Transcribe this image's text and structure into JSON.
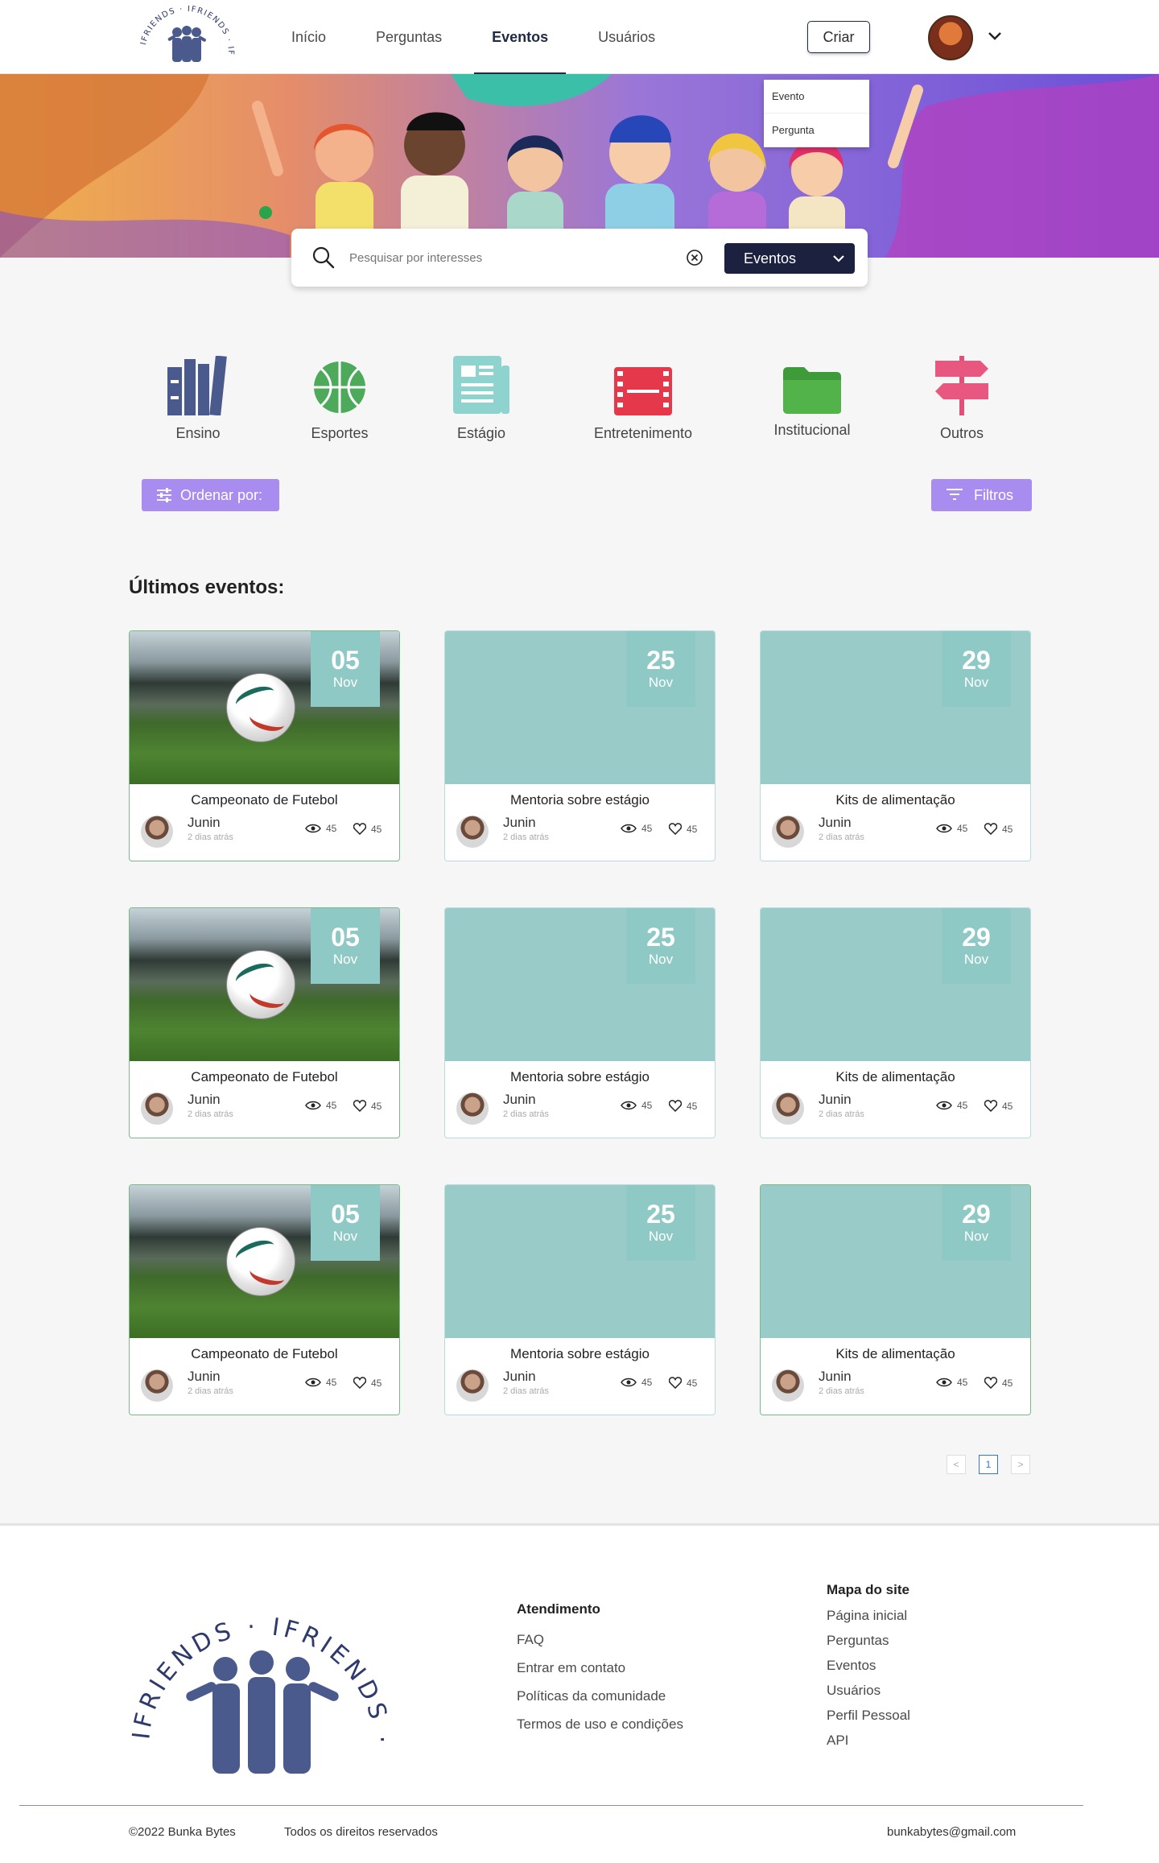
{
  "header": {
    "logo_text": "IFRIENDS",
    "nav": [
      "Início",
      "Perguntas",
      "Eventos",
      "Usuários"
    ],
    "active_nav": "Eventos",
    "create_label": "Criar",
    "create_menu": [
      "Evento",
      "Pergunta"
    ]
  },
  "search": {
    "placeholder": "Pesquisar por interesses",
    "type_selected": "Eventos"
  },
  "categories": [
    "Ensino",
    "Esportes",
    "Estágio",
    "Entretenimento",
    "Institucional",
    "Outros"
  ],
  "controls": {
    "sort_label": "Ordenar por:",
    "filter_label": "Filtros"
  },
  "section_title": "Últimos eventos:",
  "cards": [
    {
      "day": "05",
      "month": "Nov",
      "title": "Campeonato de Futebol",
      "author": "Junin",
      "time": "2 dias atrás",
      "views": "45",
      "likes": "45"
    },
    {
      "day": "25",
      "month": "Nov",
      "title": "Mentoria sobre estágio",
      "author": "Junin",
      "time": "2 dias atrás",
      "views": "45",
      "likes": "45"
    },
    {
      "day": "29",
      "month": "Nov",
      "title": "Kits de alimentação",
      "author": "Junin",
      "time": "2 dias atrás",
      "views": "45",
      "likes": "45"
    },
    {
      "day": "05",
      "month": "Nov",
      "title": "Campeonato de Futebol",
      "author": "Junin",
      "time": "2 dias atrás",
      "views": "45",
      "likes": "45"
    },
    {
      "day": "25",
      "month": "Nov",
      "title": "Mentoria sobre estágio",
      "author": "Junin",
      "time": "2 dias atrás",
      "views": "45",
      "likes": "45"
    },
    {
      "day": "29",
      "month": "Nov",
      "title": "Kits de alimentação",
      "author": "Junin",
      "time": "2 dias atrás",
      "views": "45",
      "likes": "45"
    },
    {
      "day": "05",
      "month": "Nov",
      "title": "Campeonato de Futebol",
      "author": "Junin",
      "time": "2 dias atrás",
      "views": "45",
      "likes": "45"
    },
    {
      "day": "25",
      "month": "Nov",
      "title": "Mentoria sobre estágio",
      "author": "Junin",
      "time": "2 dias atrás",
      "views": "45",
      "likes": "45"
    },
    {
      "day": "29",
      "month": "Nov",
      "title": "Kits de alimentação",
      "author": "Junin",
      "time": "2 dias atrás",
      "views": "45",
      "likes": "45"
    }
  ],
  "pagination": {
    "prev": "<",
    "current": "1",
    "next": ">"
  },
  "footer": {
    "logo_text": "IFRIENDS",
    "atendimento": {
      "title": "Atendimento",
      "links": [
        "FAQ",
        "Entrar em contato",
        "Políticas da comunidade",
        "Termos de uso e condições"
      ]
    },
    "mapa": {
      "title": "Mapa do site",
      "links": [
        "Página inicial",
        "Perguntas",
        "Eventos",
        "Usuários",
        "Perfil Pessoal",
        "API"
      ]
    },
    "copyright": "©2022 Bunka Bytes",
    "rights": "Todos os direitos reservados",
    "email": "bunkabytes@gmail.com"
  },
  "colors": {
    "navy": "#1c2140",
    "purple_button": "#a98cf0",
    "card_teal": "#99cbc8",
    "date_badge": "#8fc9c5"
  }
}
